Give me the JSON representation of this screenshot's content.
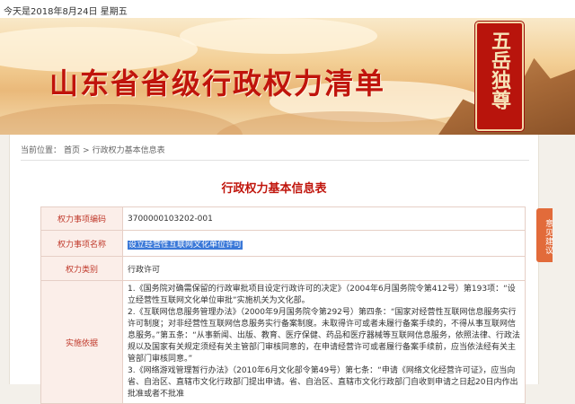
{
  "topbar": {
    "date": "今天是2018年8月24日 星期五"
  },
  "banner": {
    "title": "山东省省级行政权力清单",
    "seal_text": "五岳独尊"
  },
  "breadcrumb": {
    "prefix": "当前位置：",
    "home": "首页",
    "separator": ">",
    "current": "行政权力基本信息表"
  },
  "page_title": "行政权力基本信息表",
  "table": {
    "rows": [
      {
        "label": "权力事项编码",
        "value": "3700000103202-001"
      },
      {
        "label": "权力事项名称",
        "value": "设立经营性互联网文化单位许可"
      },
      {
        "label": "权力类别",
        "value": "行政许可"
      }
    ],
    "basis_label": "实施依据",
    "basis_paragraphs": [
      "1.《国务院对确需保留的行政审批项目设定行政许可的决定》（2004年6月国务院令第412号）第193项：“设立经营性互联网文化单位审批”实施机关为文化部。",
      "2.《互联网信息服务管理办法》（2000年9月国务院令第292号）第四条：“国家对经营性互联网信息服务实行许可制度；对非经营性互联网信息服务实行备案制度。未取得许可或者未履行备案手续的，不得从事互联网信息服务。”第五条：“从事新闻、出版、教育、医疗保健、药品和医疗器械等互联网信息服务，依照法律、行政法规以及国家有关规定须经有关主管部门审核同意的，在申请经营许可或者履行备案手续前，应当依法经有关主管部门审核同意。”",
      "3.《网络游戏管理暂行办法》（2010年6月文化部令第49号）第七条：“申请《网络文化经营许可证》，应当向省、自治区、直辖市文化行政部门提出申请。省、自治区、直辖市文化行政部门自收到申请之日起20日内作出批准或者不批准"
    ]
  },
  "feedback": {
    "label": "意见建议"
  }
}
